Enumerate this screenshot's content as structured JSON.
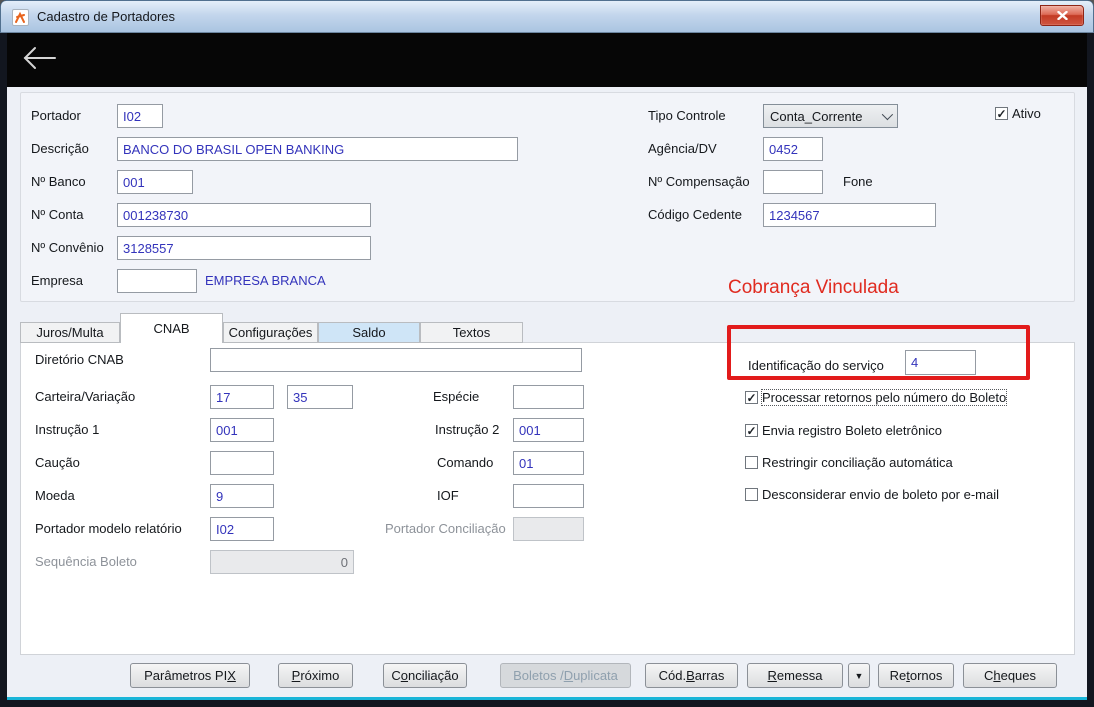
{
  "glyphs": {
    "check": "✓",
    "dropdown_arrow": "▼"
  },
  "window": {
    "title": "Cadastro de Portadores"
  },
  "top_form": {
    "portador": {
      "label": "Portador",
      "value": "I02"
    },
    "descricao": {
      "label": "Descrição",
      "value": "BANCO DO BRASIL OPEN BANKING"
    },
    "banco": {
      "label": "Nº Banco",
      "value": "001"
    },
    "conta": {
      "label": "Nº Conta",
      "value": "001238730"
    },
    "convenio": {
      "label": "Nº Convênio",
      "value": "3128557"
    },
    "empresa": {
      "label": "Empresa",
      "value": "",
      "companion": "EMPRESA BRANCA"
    },
    "tipo_controle": {
      "label": "Tipo Controle",
      "value": "Conta_Corrente"
    },
    "ativo": {
      "label": "Ativo",
      "checked": true
    },
    "agencia": {
      "label": "Agência/DV",
      "value": "0452"
    },
    "compensacao": {
      "label": "Nº Compensação",
      "value": "",
      "companion": "Fone"
    },
    "cedente": {
      "label": "Código Cedente",
      "value": "1234567"
    }
  },
  "annotation": {
    "text": "Cobrança Vinculada",
    "color": "#e02b20",
    "box_color": "#e21b1b"
  },
  "tabs": [
    {
      "label": "Juros/Multa"
    },
    {
      "label": "CNAB"
    },
    {
      "label": "Configurações"
    },
    {
      "label": "Saldo"
    },
    {
      "label": "Textos"
    }
  ],
  "cnab": {
    "diretorio": {
      "label": "Diretório CNAB",
      "value": ""
    },
    "carteira": {
      "label": "Carteira/Variação",
      "value1": "17",
      "value2": "35"
    },
    "instrucao1": {
      "label": "Instrução 1",
      "value": "001"
    },
    "caucao": {
      "label": "Caução",
      "value": ""
    },
    "moeda": {
      "label": "Moeda",
      "value": "9"
    },
    "portador_modelo": {
      "label": "Portador modelo relatório",
      "value": "I02"
    },
    "sequencia": {
      "label": "Sequência Boleto",
      "value": "0"
    },
    "especie": {
      "label": "Espécie",
      "value": ""
    },
    "instrucao2": {
      "label": "Instrução 2",
      "value": "001"
    },
    "comando": {
      "label": "Comando",
      "value": "01"
    },
    "iof": {
      "label": "IOF",
      "value": ""
    },
    "conciliacao": {
      "label": "Portador Conciliação",
      "value": ""
    },
    "identificacao": {
      "label": "Identificação do serviço",
      "value": "4"
    },
    "checkboxes": [
      {
        "label": "Processar retornos pelo número do Boleto",
        "checked": true
      },
      {
        "label": "Envia registro Boleto eletrônico",
        "checked": true
      },
      {
        "label": "Restringir conciliação automática",
        "checked": false
      },
      {
        "label": "Desconsiderar envio de boleto por e-mail",
        "checked": false
      }
    ]
  },
  "buttons": [
    {
      "pre": "Parâmetros PI",
      "key": "X",
      "post": ""
    },
    {
      "pre": "",
      "key": "P",
      "post": "róximo"
    },
    {
      "pre": "C",
      "key": "o",
      "post": "nciliação"
    },
    {
      "pre": "Boletos / ",
      "key": "D",
      "post": "uplicata"
    },
    {
      "pre": "Cód. ",
      "key": "B",
      "post": "arras"
    },
    {
      "pre": "",
      "key": "R",
      "post": "emessa"
    },
    {
      "pre": "Re",
      "key": "t",
      "post": "ornos"
    },
    {
      "pre": "C",
      "key": "h",
      "post": "eques"
    }
  ]
}
